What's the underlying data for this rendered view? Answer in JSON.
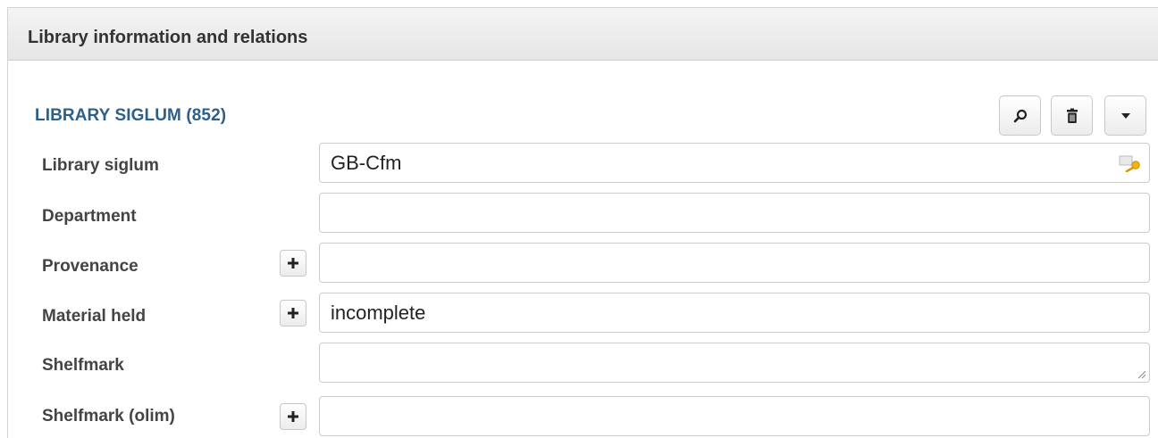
{
  "panel": {
    "title": "Library information and relations"
  },
  "section": {
    "title": "LIBRARY SIGLUM (852)",
    "actions": [
      {
        "name": "search-button",
        "icon": "magnifier-icon"
      },
      {
        "name": "delete-button",
        "icon": "trash-icon"
      },
      {
        "name": "menu-button",
        "icon": "caret-down-icon"
      }
    ]
  },
  "fields": {
    "library_siglum": {
      "label": "Library siglum",
      "value": "GB-Cfm"
    },
    "department": {
      "label": "Department",
      "value": ""
    },
    "provenance": {
      "label": "Provenance",
      "value": ""
    },
    "material_held": {
      "label": "Material held",
      "value": "incomplete"
    },
    "shelfmark": {
      "label": "Shelfmark",
      "value": ""
    },
    "shelfmark_olim": {
      "label": "Shelfmark (olim)",
      "value": ""
    }
  },
  "colors": {
    "section_title": "#2d5f8b",
    "key_icon": "#e8a800"
  }
}
